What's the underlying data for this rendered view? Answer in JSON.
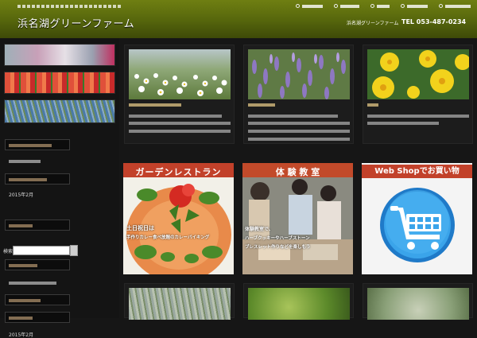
{
  "header": {
    "logo": "浜名湖グリーンファーム",
    "tel": "TEL  053-487-0234",
    "sub_name": "浜名湖グリーンファーム"
  },
  "sidebar": {
    "date1": "2015年2月",
    "date2": "2015年2月",
    "search_label": "検索:",
    "search_value": ""
  },
  "banners": {
    "restaurant_title": "ガーデンレストラン",
    "restaurant_line1": "土日祝日は",
    "restaurant_line2": "手作りカレー食べ放題のカレーバイキング",
    "taiken_title": "体 験 教 室",
    "taiken_line1": "体験教室で、",
    "taiken_line2": "ハーブクッキーやハーブストーン",
    "taiken_line3": "ブレスレット作りなどを楽しもう",
    "webshop_title": "Web Shopでお買い物"
  },
  "colors": {
    "header_top": "#6f7f12",
    "header_bottom": "#3e4a08",
    "page_bg": "#161616",
    "banner_red": "#c2412a",
    "shop_blue": "#2a8fd9"
  }
}
